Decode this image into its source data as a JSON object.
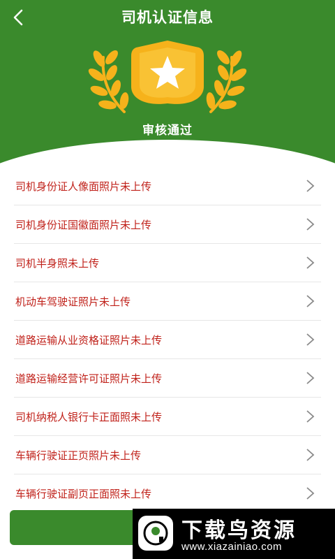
{
  "header": {
    "title": "司机认证信息",
    "status": "审核通过",
    "back_icon": "back-arrow-icon",
    "badge_icon": "star-badge-icon",
    "colors": {
      "green": "#3a8a2c",
      "gold": "#f6b21b",
      "item_text": "#c0211a"
    }
  },
  "items": [
    {
      "label": "司机身份证人像面照片未上传"
    },
    {
      "label": "司机身份证国徽面照片未上传"
    },
    {
      "label": "司机半身照未上传"
    },
    {
      "label": "机动车驾驶证照片未上传"
    },
    {
      "label": "道路运输从业资格证照片未上传"
    },
    {
      "label": "道路运输经营许可证照片未上传"
    },
    {
      "label": "司机纳税人银行卡正面照未上传"
    },
    {
      "label": "车辆行驶证正页照片未上传"
    },
    {
      "label": "车辆行驶证副页正面照未上传"
    }
  ],
  "watermark": {
    "name": "下载鸟资源",
    "url": "www.xiazainiao.com"
  }
}
